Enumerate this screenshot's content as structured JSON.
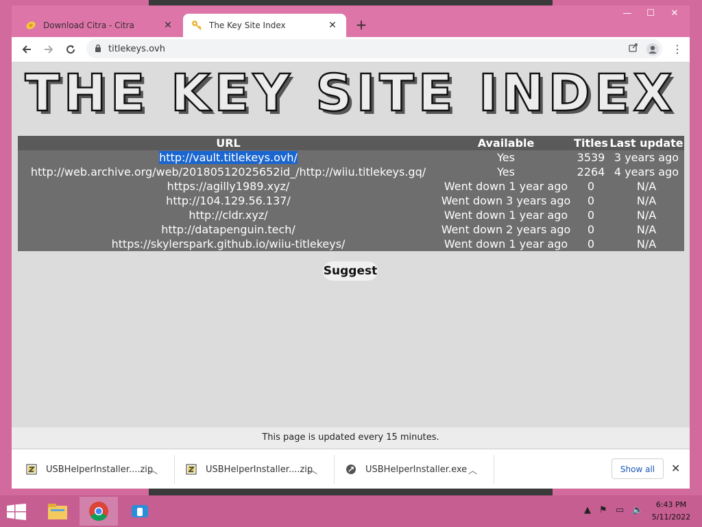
{
  "browser": {
    "tabs": [
      {
        "title": "Download Citra - Citra",
        "icon": "citra-icon"
      },
      {
        "title": "The Key Site Index",
        "icon": "key-icon"
      }
    ],
    "url": "titlekeys.ovh"
  },
  "page": {
    "banner": "THE KEY SITE INDEX",
    "table": {
      "headers": [
        "URL",
        "Available",
        "Titles",
        "Last update"
      ],
      "rows": [
        [
          "http://vault.titlekeys.ovh/",
          "Yes",
          "3539",
          "3 years ago"
        ],
        [
          "http://web.archive.org/web/20180512025652id_/http://wiiu.titlekeys.gq/",
          "Yes",
          "2264",
          "4 years ago"
        ],
        [
          "https://agilly1989.xyz/",
          "Went down 1 year ago",
          "0",
          "N/A"
        ],
        [
          "http://104.129.56.137/",
          "Went down 3 years ago",
          "0",
          "N/A"
        ],
        [
          "http://cldr.xyz/",
          "Went down 1 year ago",
          "0",
          "N/A"
        ],
        [
          "http://datapenguin.tech/",
          "Went down 2 years ago",
          "0",
          "N/A"
        ],
        [
          "https://skylerspark.github.io/wiiu-titlekeys/",
          "Went down 1 year ago",
          "0",
          "N/A"
        ]
      ]
    },
    "suggest": "Suggest",
    "footer": "This page is updated every 15 minutes."
  },
  "downloads": {
    "items": [
      {
        "name": "USBHelperInstaller....zip",
        "icon": "zip-icon"
      },
      {
        "name": "USBHelperInstaller....zip",
        "icon": "zip-icon"
      },
      {
        "name": "USBHelperInstaller.exe",
        "icon": "exe-icon"
      }
    ],
    "show_all": "Show all"
  },
  "taskbar": {
    "time": "6:43 PM",
    "date": "5/11/2022"
  },
  "colors": {
    "desktop": "#d36a9e",
    "tabstrip": "#de75a8",
    "table_bg": "#6e6e6e",
    "selection": "#1a66d0"
  }
}
